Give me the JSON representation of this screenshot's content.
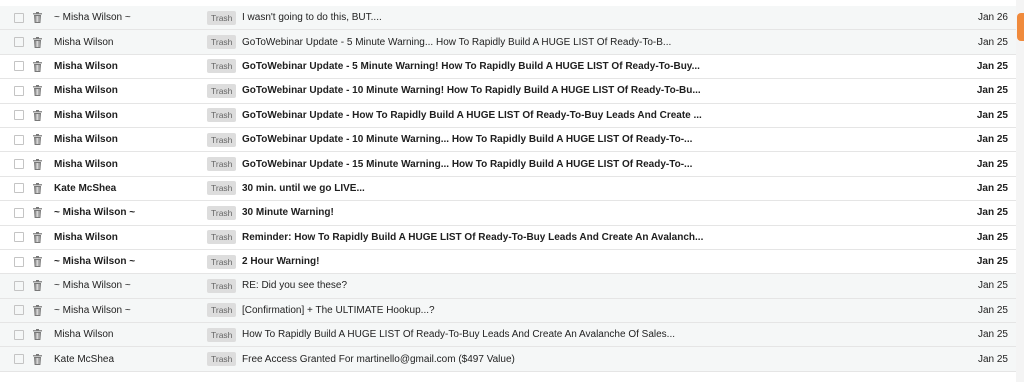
{
  "colors": {
    "unread_bg": "#ffffff",
    "read_bg": "#f5f7f7",
    "badge_bg": "#dddddd",
    "scroll_thumb": "#f08a3c"
  },
  "label": "Trash",
  "emails": [
    {
      "sender": "~ Misha Wilson ~",
      "subject": "I wasn't going to do this, BUT....",
      "date": "Jan 26",
      "unread": false
    },
    {
      "sender": "Misha Wilson",
      "subject": "GoToWebinar Update - 5 Minute Warning... How To Rapidly Build A HUGE LIST Of Ready-To-B...",
      "date": "Jan 25",
      "unread": false
    },
    {
      "sender": "Misha Wilson",
      "subject": "GoToWebinar Update - 5 Minute Warning! How To Rapidly Build A HUGE LIST Of Ready-To-Buy...",
      "date": "Jan 25",
      "unread": true
    },
    {
      "sender": "Misha Wilson",
      "subject": "GoToWebinar Update - 10 Minute Warning! How To Rapidly Build A HUGE LIST Of Ready-To-Bu...",
      "date": "Jan 25",
      "unread": true
    },
    {
      "sender": "Misha Wilson",
      "subject": "GoToWebinar Update - How To Rapidly Build A HUGE LIST Of Ready-To-Buy Leads And Create ...",
      "date": "Jan 25",
      "unread": true
    },
    {
      "sender": "Misha Wilson",
      "subject": "GoToWebinar Update - 10 Minute Warning... How To Rapidly Build A HUGE LIST Of Ready-To-...",
      "date": "Jan 25",
      "unread": true
    },
    {
      "sender": "Misha Wilson",
      "subject": "GoToWebinar Update - 15 Minute Warning... How To Rapidly Build A HUGE LIST Of Ready-To-...",
      "date": "Jan 25",
      "unread": true
    },
    {
      "sender": "Kate McShea",
      "subject": "30 min. until we go LIVE...",
      "date": "Jan 25",
      "unread": true
    },
    {
      "sender": "~ Misha Wilson ~",
      "subject": "30 Minute Warning!",
      "date": "Jan 25",
      "unread": true
    },
    {
      "sender": "Misha Wilson",
      "subject": "Reminder: How To Rapidly Build A HUGE LIST Of Ready-To-Buy Leads And Create An Avalanch...",
      "date": "Jan 25",
      "unread": true
    },
    {
      "sender": "~ Misha Wilson ~",
      "subject": "2 Hour Warning!",
      "date": "Jan 25",
      "unread": true
    },
    {
      "sender": "~ Misha Wilson ~",
      "subject": "RE: Did you see these?",
      "date": "Jan 25",
      "unread": false
    },
    {
      "sender": "~ Misha Wilson ~",
      "subject": "[Confirmation] + The ULTIMATE Hookup...?",
      "date": "Jan 25",
      "unread": false
    },
    {
      "sender": "Misha Wilson",
      "subject": "How To Rapidly Build A HUGE LIST Of Ready-To-Buy Leads And Create An Avalanche Of Sales...",
      "date": "Jan 25",
      "unread": false
    },
    {
      "sender": "Kate McShea",
      "subject": "Free Access Granted For martinello@gmail.com ($497 Value)",
      "date": "Jan 25",
      "unread": false
    }
  ]
}
